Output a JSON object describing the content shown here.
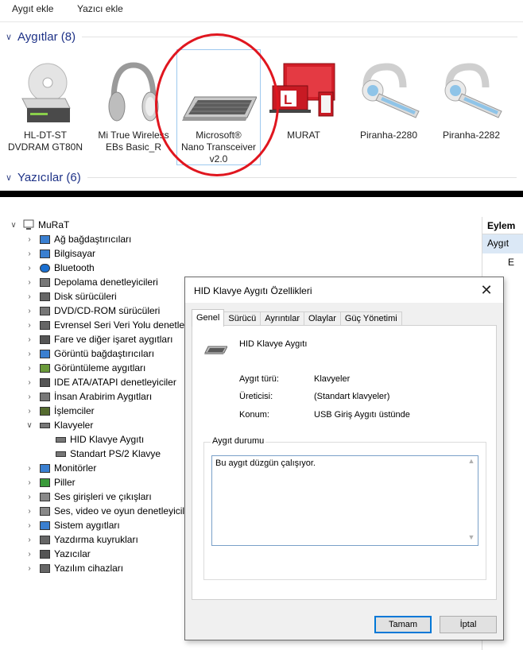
{
  "toolbar": {
    "add_device": "Aygıt ekle",
    "add_printer": "Yazıcı ekle"
  },
  "devices_group": {
    "label": "Aygıtlar (8)",
    "items": [
      {
        "line1": "HL-DT-ST",
        "line2": "DVDRAM GT80N",
        "line3": "",
        "icon": "optical-drive-icon"
      },
      {
        "line1": "Mi True Wireless",
        "line2": "EBs Basic_R",
        "line3": "",
        "icon": "headphones-icon"
      },
      {
        "line1": "Microsoft®",
        "line2": "Nano Transceiver",
        "line3": "v2.0",
        "icon": "keyboard-icon"
      },
      {
        "line1": "MURAT",
        "line2": "",
        "line3": "",
        "icon": "computer-icon"
      },
      {
        "line1": "Piranha-2280",
        "line2": "",
        "line3": "",
        "icon": "headset-icon"
      },
      {
        "line1": "Piranha-2282",
        "line2": "",
        "line3": "",
        "icon": "headset-icon"
      }
    ]
  },
  "printers_group": {
    "label": "Yazıcılar (6)"
  },
  "tree": {
    "root": "MuRaT",
    "items": [
      "Ağ bağdaştırıcıları",
      "Bilgisayar",
      "Bluetooth",
      "Depolama denetleyicileri",
      "Disk sürücüleri",
      "DVD/CD-ROM sürücüleri",
      "Evrensel Seri Veri Yolu denetleyi",
      "Fare ve diğer işaret aygıtları",
      "Görüntü bağdaştırıcıları",
      "Görüntüleme aygıtları",
      "IDE ATA/ATAPI denetleyiciler",
      "İnsan Arabirim Aygıtları",
      "İşlemciler",
      "Klavyeler",
      "HID Klavye Aygıtı",
      "Standart PS/2 Klavye",
      "Monitörler",
      "Piller",
      "Ses girişleri ve çıkışları",
      "Ses, video ve oyun denetleyicile",
      "Sistem aygıtları",
      "Yazdırma kuyrukları",
      "Yazıcılar",
      "Yazılım cihazları"
    ]
  },
  "actions_pane": {
    "header": "Eylem",
    "selected": "Aygıt",
    "more": "E"
  },
  "dialog": {
    "title": "HID Klavye Aygıtı Özellikleri",
    "tabs": [
      "Genel",
      "Sürücü",
      "Ayrıntılar",
      "Olaylar",
      "Güç Yönetimi"
    ],
    "device_name": "HID Klavye Aygıtı",
    "props": [
      {
        "label": "Aygıt türü:",
        "value": "Klavyeler"
      },
      {
        "label": "Üreticisi:",
        "value": "(Standart klavyeler)"
      },
      {
        "label": "Konum:",
        "value": "USB Giriş Aygıtı üstünde"
      }
    ],
    "status_group": "Aygıt durumu",
    "status_text": "Bu aygıt düzgün çalışıyor.",
    "ok": "Tamam",
    "cancel": "İptal"
  },
  "colors": {
    "group_header": "#1e3287",
    "highlight_circle": "#e0161f",
    "selection_border": "#9ec9ef",
    "default_button": "#0078d7"
  }
}
